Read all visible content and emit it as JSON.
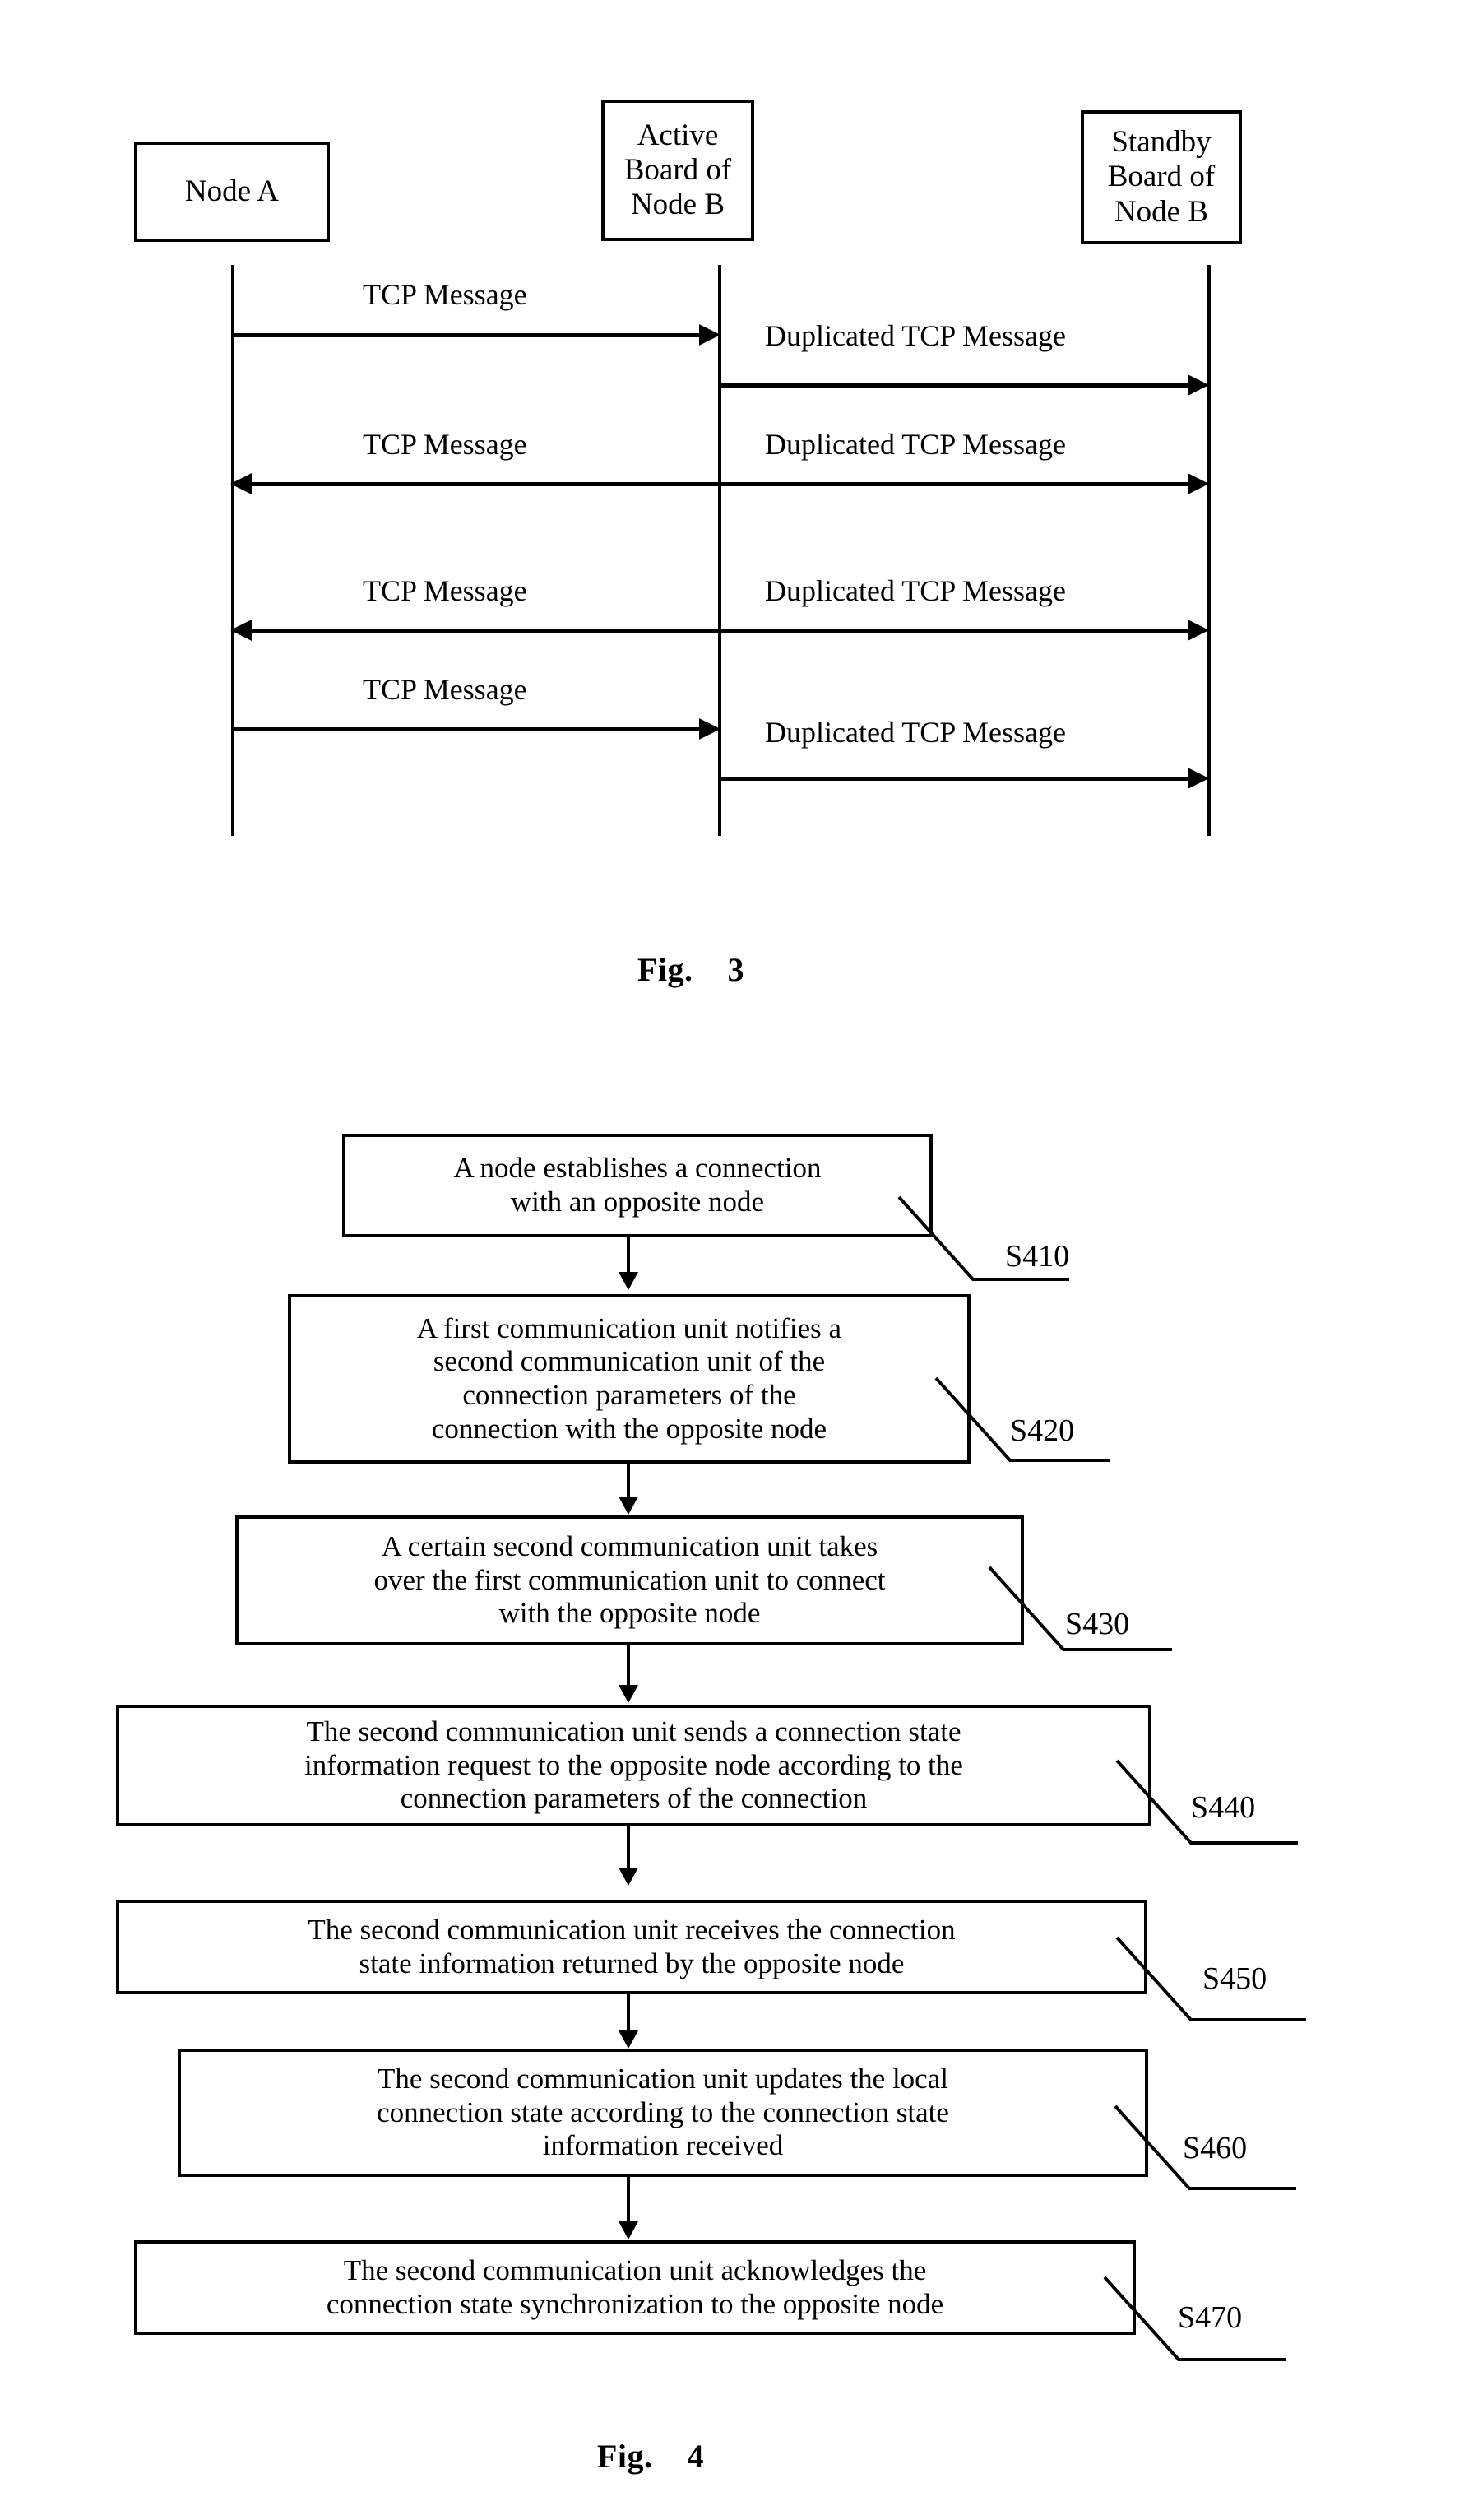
{
  "figures": [
    {
      "caption": "Fig.    3",
      "type": "sequence-diagram",
      "actors": [
        {
          "id": "node-a",
          "label": "Node A"
        },
        {
          "id": "active-board",
          "label": "Active\nBoard of\nNode B"
        },
        {
          "id": "standby-board",
          "label": "Standby\nBoard of\nNode B"
        }
      ],
      "messages": [
        {
          "id": "m1",
          "label": "TCP Message",
          "from": "node-a",
          "to": "active-board",
          "direction": "right"
        },
        {
          "id": "m2",
          "label": "Duplicated TCP Message",
          "from": "active-board",
          "to": "standby-board",
          "direction": "right"
        },
        {
          "id": "m3",
          "label": "TCP Message",
          "from": "active-board",
          "to": "node-a",
          "direction": "left"
        },
        {
          "id": "m4",
          "label": "Duplicated TCP Message",
          "from": "active-board",
          "to": "standby-board",
          "direction": "right"
        },
        {
          "id": "m5",
          "label": "TCP Message",
          "from": "active-board",
          "to": "node-a",
          "direction": "left"
        },
        {
          "id": "m6",
          "label": "Duplicated TCP Message",
          "from": "active-board",
          "to": "standby-board",
          "direction": "right"
        },
        {
          "id": "m7",
          "label": "TCP Message",
          "from": "node-a",
          "to": "active-board",
          "direction": "right"
        },
        {
          "id": "m8",
          "label": "Duplicated TCP Message",
          "from": "active-board",
          "to": "standby-board",
          "direction": "right"
        }
      ]
    },
    {
      "caption": "Fig.    4",
      "type": "flowchart",
      "steps": [
        {
          "id": "S410",
          "text": "A node establishes a connection\nwith an opposite node"
        },
        {
          "id": "S420",
          "text": "A first communication unit notifies a\nsecond communication unit of the\nconnection parameters of the\nconnection with the opposite node"
        },
        {
          "id": "S430",
          "text": "A certain second communication unit takes\nover the first communication unit to connect\nwith the opposite node"
        },
        {
          "id": "S440",
          "text": "The second communication unit sends a connection state\ninformation request to the opposite node according to the\nconnection parameters of the connection"
        },
        {
          "id": "S450",
          "text": "The second communication unit receives the connection\nstate information returned by the opposite node"
        },
        {
          "id": "S460",
          "text": "The second communication unit updates the local\nconnection state according to the connection state\ninformation received"
        },
        {
          "id": "S470",
          "text": "The second communication unit acknowledges the\nconnection state synchronization to the opposite node"
        }
      ]
    }
  ],
  "colors": {
    "ink": "#000000",
    "paper": "#ffffff"
  }
}
